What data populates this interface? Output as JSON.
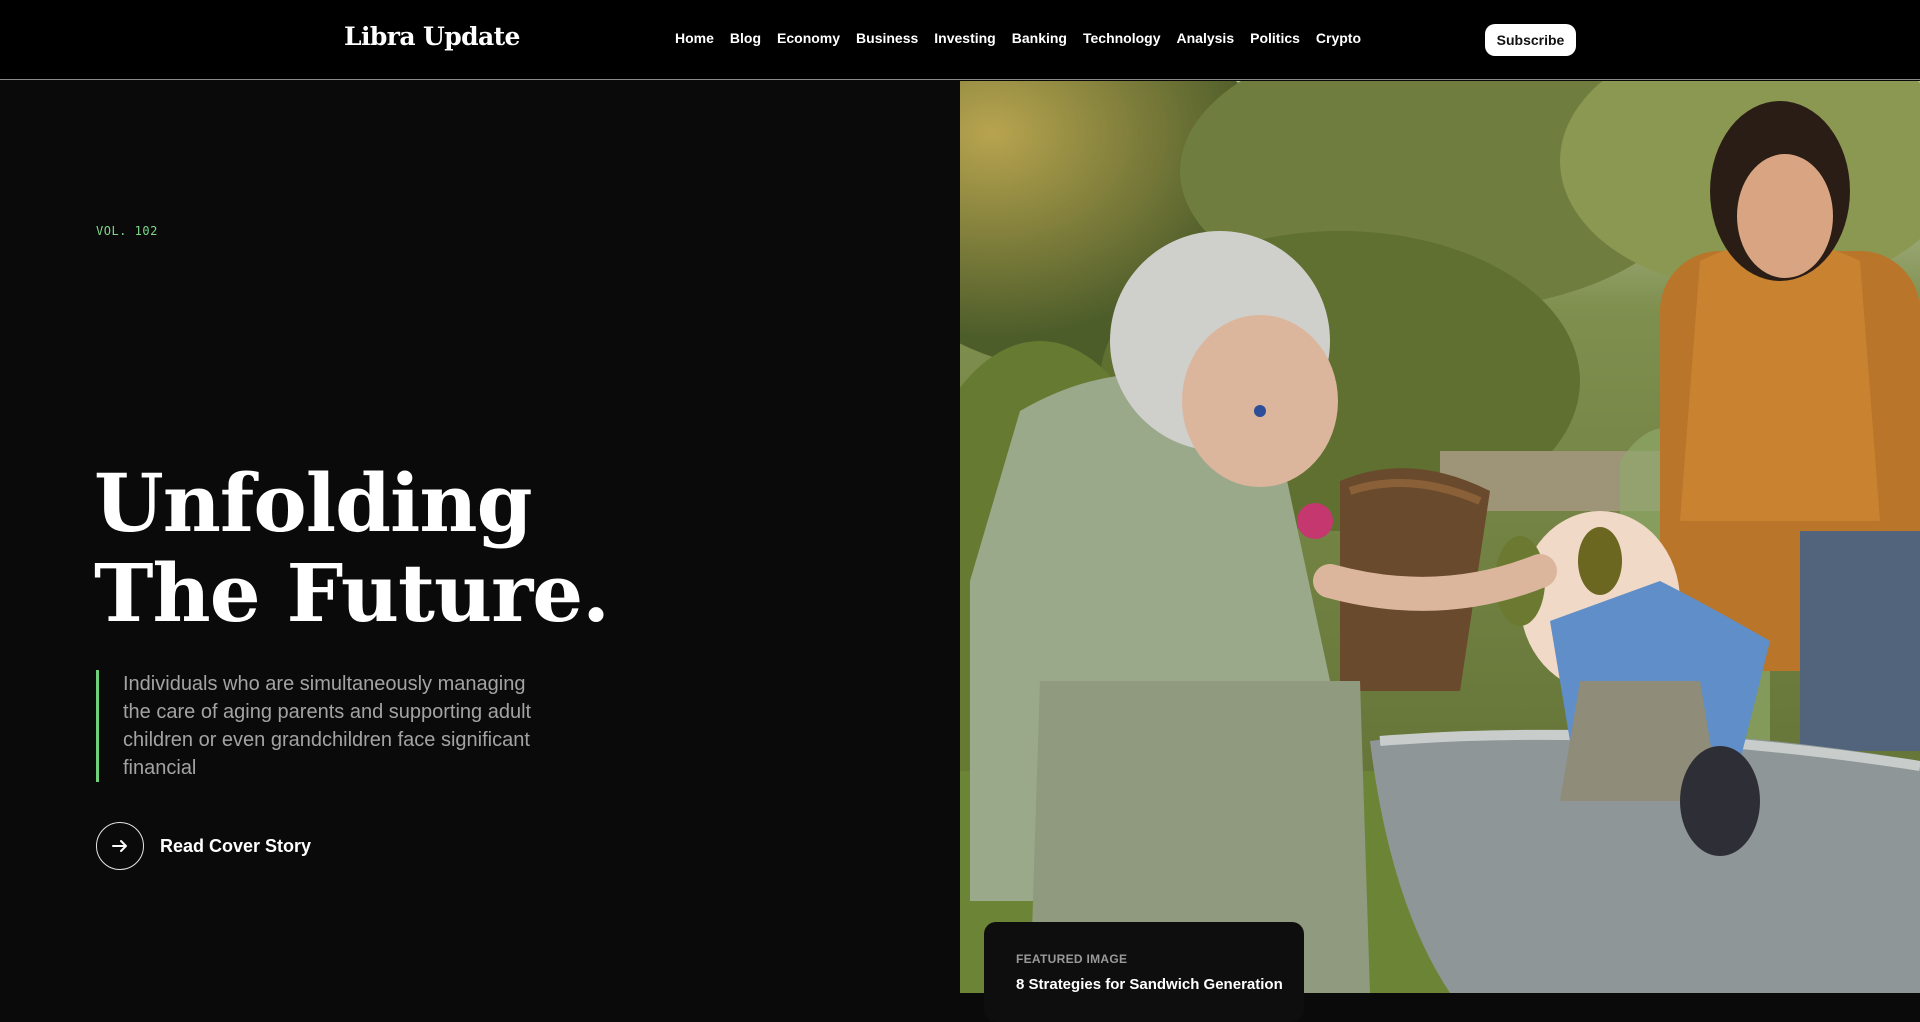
{
  "header": {
    "logo": "Libra Update",
    "nav": [
      "Home",
      "Blog",
      "Economy",
      "Business",
      "Investing",
      "Banking",
      "Technology",
      "Analysis",
      "Politics",
      "Crypto"
    ],
    "subscribe_label": "Subscribe"
  },
  "hero": {
    "volume": "VOL. 102",
    "headline_line1": "Unfolding",
    "headline_line2": "The Future.",
    "lede": "Individuals who are simultaneously managing the care of aging parents and supporting adult children or even grandchildren face significant financial",
    "cta_label": "Read Cover Story",
    "cta_icon": "arrow-right-icon"
  },
  "featured": {
    "label": "FEATURED IMAGE",
    "title": "8 Strategies for Sandwich Generation"
  },
  "colors": {
    "background": "#0a0a0a",
    "accent_green": "#6fcf7b",
    "text_muted": "#a3a3a3"
  }
}
